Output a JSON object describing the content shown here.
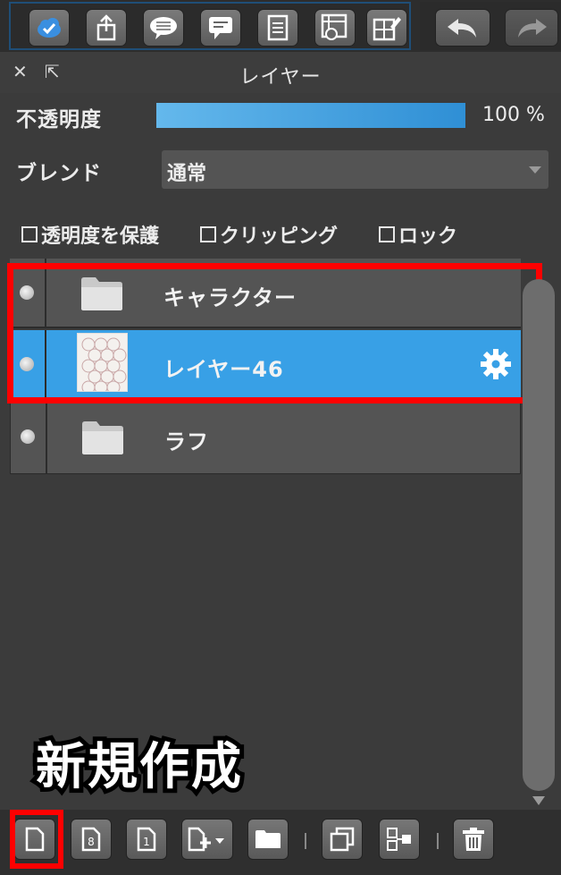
{
  "toolbar": {
    "buttons": [
      {
        "name": "cloud-check-icon"
      },
      {
        "name": "share-icon"
      },
      {
        "name": "speech-bubble-icon"
      },
      {
        "name": "comment-icon"
      },
      {
        "name": "document-icon"
      },
      {
        "name": "settings-list-icon"
      },
      {
        "name": "edit-grid-icon"
      }
    ],
    "undo": "undo-icon",
    "redo": "redo-icon"
  },
  "panel": {
    "title": "レイヤー",
    "close_icon": "✕",
    "popout_icon": "⇱"
  },
  "opacity": {
    "label": "不透明度",
    "value": "100 %",
    "level": 1.0,
    "bar_color": "#3c9ee0"
  },
  "blend": {
    "label": "ブレンド",
    "value": "通常"
  },
  "checkboxes": [
    {
      "label": "透明度を保護",
      "checked": false
    },
    {
      "label": "クリッピング",
      "checked": false
    },
    {
      "label": "ロック",
      "checked": false
    }
  ],
  "layers": [
    {
      "name": "キャラクター",
      "type": "folder",
      "selected": false
    },
    {
      "name": "レイヤー46",
      "type": "layer",
      "selected": true
    },
    {
      "name": "ラフ",
      "type": "folder",
      "selected": false
    }
  ],
  "overlay_caption": "新規作成",
  "bottom_toolbar": [
    "new-layer-icon",
    "layer-8bit-icon",
    "layer-1bit-icon",
    "add-layer-menu-icon",
    "new-folder-icon",
    "duplicate-layer-icon",
    "merge-layer-icon",
    "trash-icon"
  ],
  "colors": {
    "selection": "#38a0e6",
    "highlight_box": "#ff0000"
  }
}
